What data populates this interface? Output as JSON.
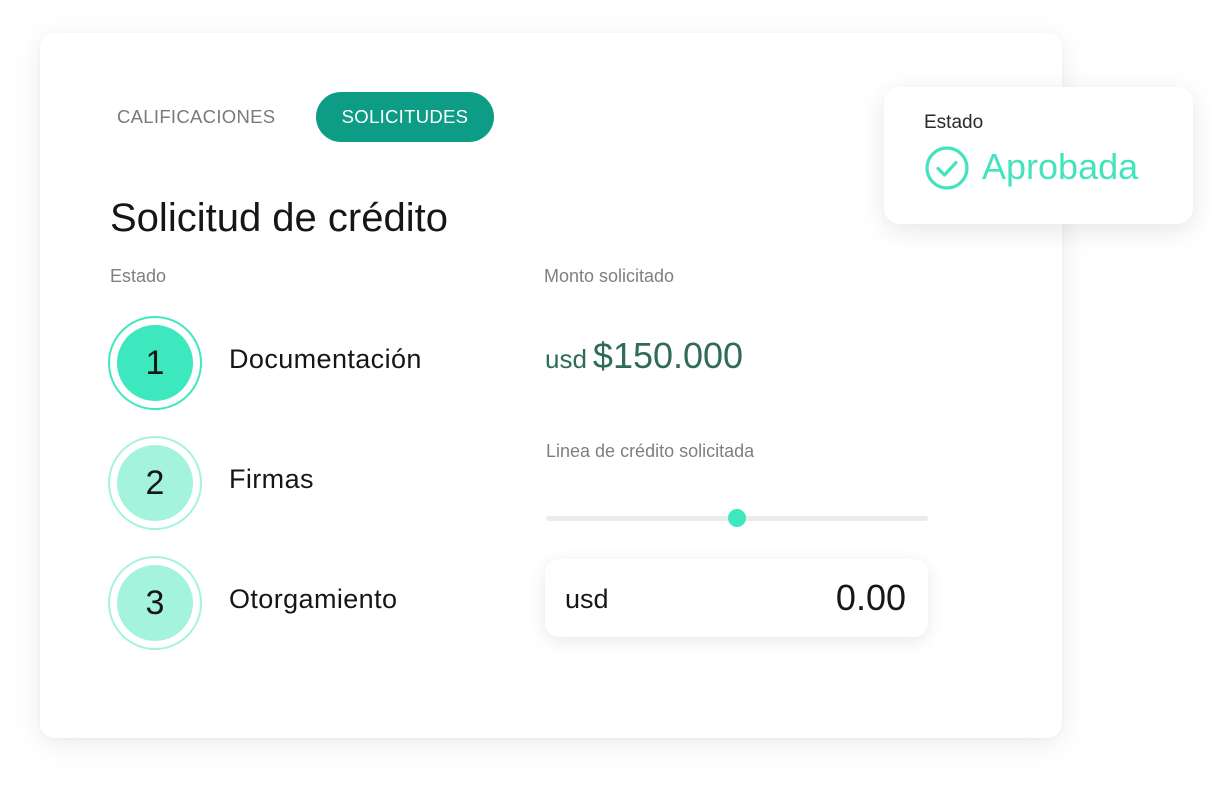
{
  "tabs": [
    {
      "label": "CALIFICACIONES",
      "active": false
    },
    {
      "label": "SOLICITUDES",
      "active": true
    }
  ],
  "title": "Solicitud de crédito",
  "steps_label": "Estado",
  "steps": [
    {
      "number": "1",
      "label": "Documentación",
      "active": true
    },
    {
      "number": "2",
      "label": "Firmas",
      "active": false
    },
    {
      "number": "3",
      "label": "Otorgamiento",
      "active": false
    }
  ],
  "amount": {
    "label": "Monto solicitado",
    "currency": "usd",
    "value": "$150.000"
  },
  "credit_line": {
    "label": "Linea de crédito solicitada",
    "slider_fraction": 0.5,
    "currency": "usd",
    "value": "0.00"
  },
  "status_card": {
    "label": "Estado",
    "value": "Aprobada",
    "icon": "check-circle-icon"
  },
  "colors": {
    "tab_active_bg": "#0d9d86",
    "step_active_fill": "#3ee8be",
    "step_active_ring": "#3ee8be",
    "step_inactive_fill": "#a4f3dd",
    "step_inactive_ring": "#a4f3dd",
    "amount_text": "#2f6b5b",
    "slider_thumb": "#3ee8be",
    "status_accent": "#43e3be"
  }
}
